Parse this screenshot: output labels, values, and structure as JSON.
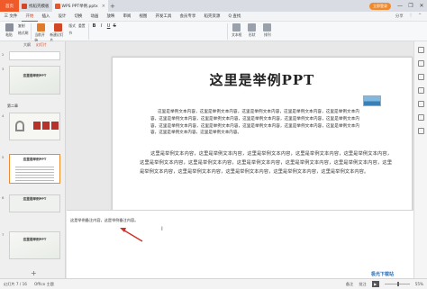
{
  "titlebar": {
    "home_tab": "首页",
    "tabs": [
      {
        "label": "找稻壳模板",
        "icon_color": "#d24726"
      },
      {
        "label": "WPS PPT举例.pptx",
        "icon_color": "#e2572c"
      }
    ],
    "plus": "+",
    "login": "立即登录",
    "min": "—",
    "max": "❐",
    "close": "✕"
  },
  "menu": {
    "items": [
      "三 文件",
      "开始",
      "插入",
      "设计",
      "切换",
      "动画",
      "放映",
      "审阅",
      "视图",
      "开发工具",
      "会员专享",
      "稻壳资源",
      "Q 查找"
    ],
    "active_index": 1,
    "right": [
      "分享",
      "⋮",
      "^"
    ]
  },
  "ribbon": {
    "buttons": [
      {
        "label": "粘贴",
        "color": "#8a8f99"
      },
      {
        "label": "格式刷",
        "color": "#b0b4bb"
      },
      {
        "label": "当前开始",
        "color": "#e07b2c"
      },
      {
        "label": "新建幻灯片",
        "color": "#d24726"
      },
      {
        "label": "版式",
        "color": "#a0a4ab"
      },
      {
        "label": "节",
        "color": "#a0a4ab"
      }
    ],
    "small": [
      "复制",
      "重置"
    ],
    "format": {
      "bold": "B",
      "italic": "I",
      "underline": "U",
      "strike": "S"
    },
    "right_buttons": [
      {
        "label": "文本框",
        "color": "#9aa1ab"
      },
      {
        "label": "形状",
        "color": "#9aa1ab"
      },
      {
        "label": "排列",
        "color": "#9aa1ab"
      }
    ]
  },
  "sidebar": {
    "tab_outline": "大纲",
    "tab_slides": "幻灯片",
    "section_label": "第二章",
    "thumbs": [
      {
        "num": "2",
        "title": "这里是举例PPT"
      },
      {
        "num": "3",
        "title": ""
      },
      {
        "num": "4",
        "title": ""
      },
      {
        "num": "5",
        "title": "这里是举例PPT"
      },
      {
        "num": "6",
        "title": "这里是举例PPT"
      },
      {
        "num": "7",
        "title": "这里是举例PPT"
      }
    ],
    "add": "+"
  },
  "slide": {
    "title": "这里是举例PPT",
    "para1": "这里是举例文本内容，这里是举例文本内容，这里是举例文本内容，这里是举例文本内容，这里是举例文本内容，这里是举例文本内容，这里是举例文本内容，这里是举例文本内容，这里是举例文本内容，这里是举例文本内容，这里是举例文本内容，这里是举例文本内容，这里是举例文本内容，这里是举例文本内容，这里是举例文本内容，这里是举例文本内容，这里是举例文本内容。",
    "para2": "这里是举例文本内容，这里是举例文本内容，这里是举例文本内容，这里是举例文本内容，这里是举例文本内容，这里是举例文本内容，这里是举例文本内容，这里是举例文本内容，这里是举例文本内容，这里是举例文本内容，这里是举例文本内容，这里是举例文本内容，这里是举例文本内容，这里是举例文本内容，这里是举例文本内容。"
  },
  "notes": {
    "text": "这是举例备注内容，这是举例备注内容。"
  },
  "status": {
    "slide_pos": "幻灯片 7 / 16",
    "theme": "Office 主题",
    "notes_btn": "备注",
    "comment_btn": "批注",
    "play": "▶",
    "zoom": "55%"
  },
  "watermark": "极光下载站",
  "colors": {
    "accent": "#d24726",
    "arrow": "#d0312d"
  }
}
